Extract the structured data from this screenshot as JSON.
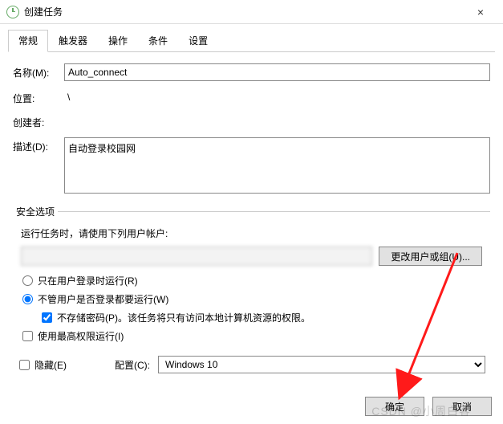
{
  "window": {
    "title": "创建任务",
    "close": "×"
  },
  "tabs": [
    "常规",
    "触发器",
    "操作",
    "条件",
    "设置"
  ],
  "fields": {
    "name_label": "名称(M):",
    "name_value": "Auto_connect",
    "location_label": "位置:",
    "location_value": "\\",
    "author_label": "创建者:",
    "author_value": "        ",
    "desc_label": "描述(D):",
    "desc_value": "自动登录校园网"
  },
  "security": {
    "legend": "安全选项",
    "run_as_label": "运行任务时，请使用下列用户帐户:",
    "account_value": "",
    "change_user_btn": "更改用户或组(U)...",
    "radio_logged_on": "只在用户登录时运行(R)",
    "radio_any": "不管用户是否登录都要运行(W)",
    "no_store_pwd": "不存储密码(P)。该任务将只有访问本地计算机资源的权限。",
    "highest_priv": "使用最高权限运行(I)"
  },
  "bottom": {
    "hidden": "隐藏(E)",
    "configure_label": "配置(C):",
    "configure_value": "Windows 10"
  },
  "footer": {
    "ok": "确定",
    "cancel": "取消"
  },
  "watermark": "CSDN @小周白客"
}
